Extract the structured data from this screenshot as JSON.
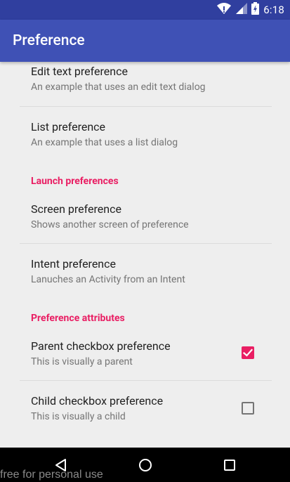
{
  "status_bar": {
    "time": "6:18",
    "icons": [
      "wifi-icon",
      "signal-icon",
      "battery-icon"
    ]
  },
  "app_bar": {
    "title": "Preference"
  },
  "preferences": {
    "edit_text": {
      "title": "Edit text preference",
      "summary": "An example that uses an edit text dialog"
    },
    "list": {
      "title": "List preference",
      "summary": "An example that uses a list dialog"
    },
    "launch_category": "Launch preferences",
    "screen": {
      "title": "Screen preference",
      "summary": "Shows another screen of preference"
    },
    "intent": {
      "title": "Intent preference",
      "summary": "Lanuches an Activity from an Intent"
    },
    "attributes_category": "Preference attributes",
    "parent_checkbox": {
      "title": "Parent checkbox preference",
      "summary": "This is visually a parent",
      "checked": true
    },
    "child_checkbox": {
      "title": "Child checkbox preference",
      "summary": "This is visually a child",
      "checked": false
    }
  },
  "nav_bar": {
    "buttons": [
      "back-icon",
      "home-icon",
      "recents-icon"
    ]
  },
  "watermark": "free for personal use",
  "colors": {
    "primary": "#3F51B5",
    "primary_dark": "#303F9F",
    "accent": "#E91E63",
    "background": "#EEEEEE"
  }
}
